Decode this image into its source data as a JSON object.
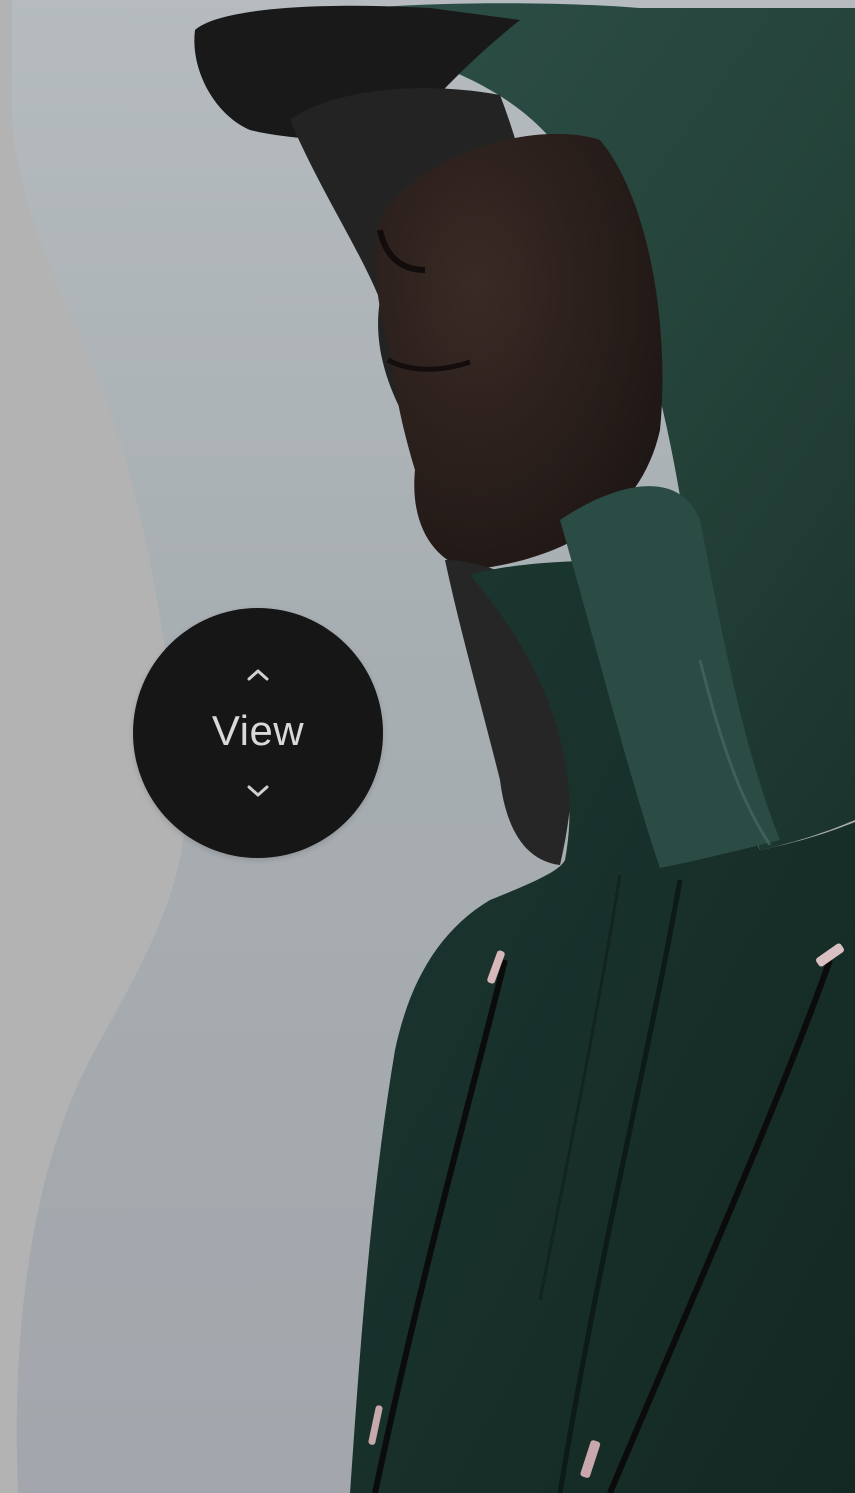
{
  "view_control": {
    "label": "View",
    "up_icon": "chevron-up-icon",
    "down_icon": "chevron-down-icon",
    "background_color": "#161616",
    "text_color": "#d9d9d9"
  },
  "hero": {
    "jacket_color": "#1f3a34",
    "backdrop_color": "#b3b3b3"
  }
}
